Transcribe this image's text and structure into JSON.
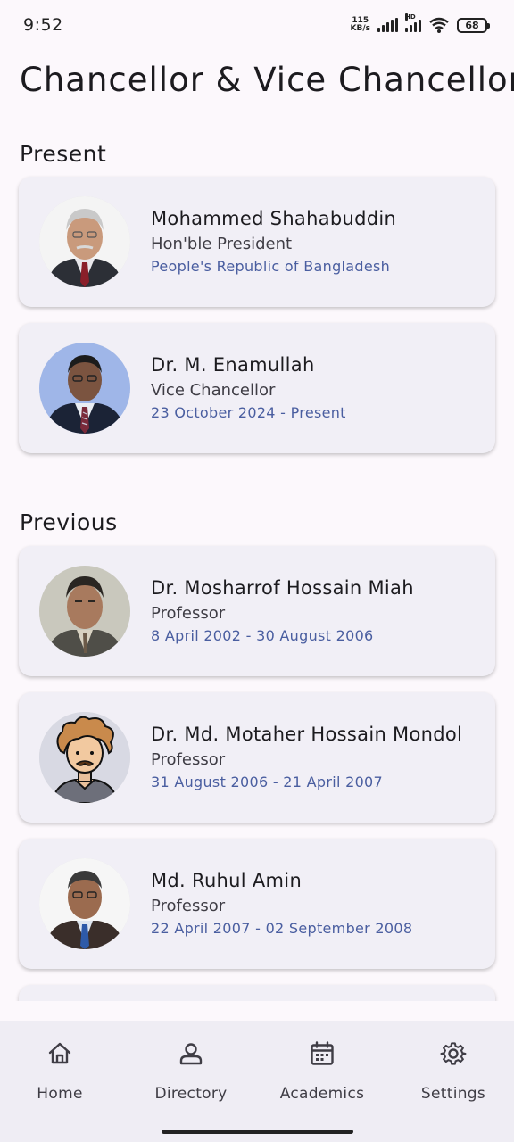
{
  "status_bar": {
    "time": "9:52",
    "net_speed_value": "115",
    "net_speed_unit": "KB/s",
    "network_label": "HD",
    "battery": "68"
  },
  "page": {
    "title": "Chancellor & Vice Chancellors"
  },
  "sections": {
    "present_title": "Present",
    "previous_title": "Previous"
  },
  "present": [
    {
      "name": "Mohammed Shahabuddin",
      "role": "Hon'ble President",
      "detail": "People's Republic of Bangladesh"
    },
    {
      "name": "Dr. M. Enamullah",
      "role": "Vice Chancellor",
      "detail": "23 October 2024 - Present"
    }
  ],
  "previous": [
    {
      "name": "Dr. Mosharrof Hossain Miah",
      "role": "Professor",
      "detail": "8 April 2002 - 30 August 2006"
    },
    {
      "name": "Dr. Md. Motaher Hossain Mondol",
      "role": "Professor",
      "detail": "31 August 2006 - 21 April 2007"
    },
    {
      "name": "Md. Ruhul Amin",
      "role": "Professor",
      "detail": "22 April 2007 - 02 September 2008"
    }
  ],
  "bottom_nav": {
    "home": "Home",
    "directory": "Directory",
    "academics": "Academics",
    "settings": "Settings"
  },
  "colors": {
    "background": "#fcf8fc",
    "card": "#f1eff6",
    "accent_text": "#4a5ea0",
    "nav_bar": "#efedf4"
  }
}
